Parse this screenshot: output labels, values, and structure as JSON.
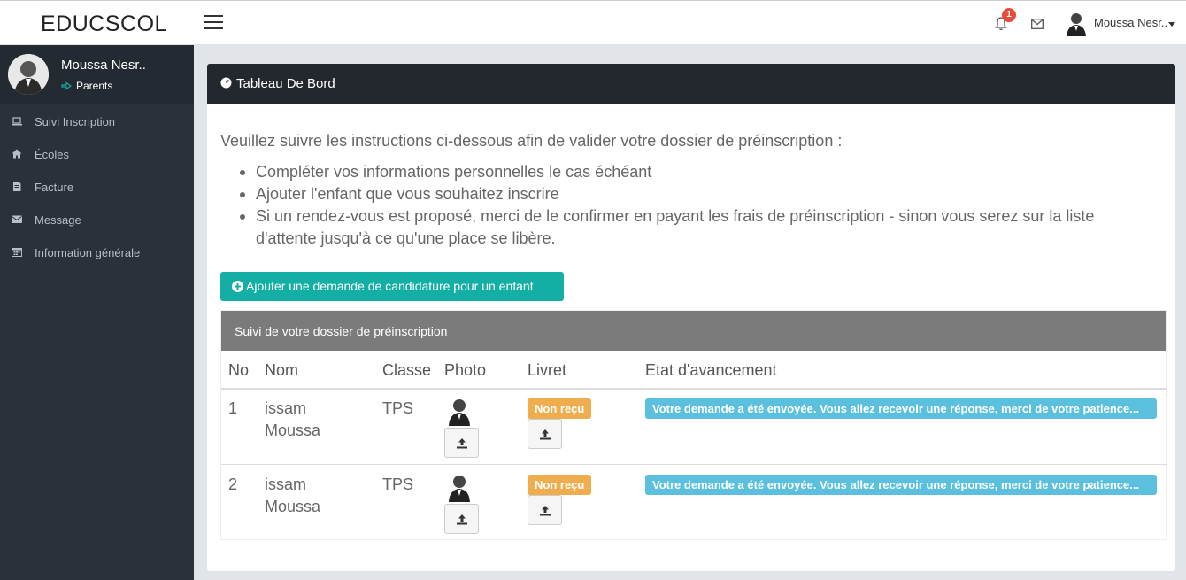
{
  "header": {
    "brand": "EDUCSCOL",
    "notification_count": "1",
    "user_name": "Moussa Nesr.."
  },
  "sidebar": {
    "profile_name": "Moussa Nesr..",
    "profile_role": "Parents",
    "items": [
      {
        "label": "Suivi Inscription",
        "icon": "laptop-icon"
      },
      {
        "label": "Écoles",
        "icon": "home-icon"
      },
      {
        "label": "Facture",
        "icon": "file-icon"
      },
      {
        "label": "Message",
        "icon": "envelope-icon"
      },
      {
        "label": "Information générale",
        "icon": "calendar-icon"
      }
    ]
  },
  "main": {
    "title": "Tableau De Bord",
    "intro": "Veuillez suivre les instructions ci-dessous afin de valider votre dossier de préinscription :",
    "bullets": [
      "Compléter vos informations personnelles le cas échéant",
      "Ajouter l'enfant que vous souhaitez inscrire",
      "Si un rendez-vous est proposé, merci de le confirmer en payant les frais de préinscription - sinon vous serez sur la liste d'attente jusqu'à ce qu'une place se libère."
    ],
    "add_button": "Ajouter une demande de candidature pour un enfant",
    "box_title": "Suivi de votre dossier de préinscription",
    "table": {
      "headers": [
        "No",
        "Nom",
        "Classe",
        "Photo",
        "Livret",
        "Etat d'avancement"
      ],
      "rows": [
        {
          "no": "1",
          "nom_line1": "issam",
          "nom_line2": "Moussa",
          "classe": "TPS",
          "livret": "Non reçu",
          "etat": "Votre demande a été envoyée. Vous allez recevoir une réponse, merci de votre patience..."
        },
        {
          "no": "2",
          "nom_line1": "issam",
          "nom_line2": "Moussa",
          "classe": "TPS",
          "livret": "Non reçu",
          "etat": "Votre demande a été envoyée. Vous allez recevoir une réponse, merci de votre patience..."
        }
      ]
    }
  },
  "colors": {
    "sidebar_bg": "#2a3139",
    "panel_header": "#23282e",
    "button_teal": "#13aea4",
    "label_warning": "#f0ad4e",
    "label_info": "#5bc0de",
    "box_header": "#7b7b7b"
  }
}
